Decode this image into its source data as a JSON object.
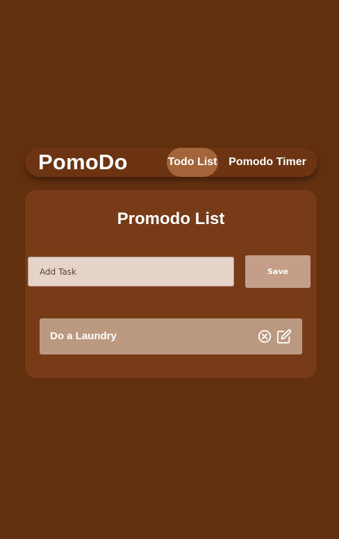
{
  "navbar": {
    "brand": "PomoDo",
    "links": [
      {
        "label": "Todo List",
        "active": true
      },
      {
        "label": "Pomodo Timer",
        "active": false
      }
    ]
  },
  "todo": {
    "title": "Promodo List",
    "input": {
      "placeholder": "Add Task",
      "value": ""
    },
    "save_label": "Save",
    "tasks": [
      {
        "label": "Do a Laundry"
      }
    ]
  },
  "icons": {
    "delete": "circle-x-icon",
    "edit": "edit-icon"
  },
  "colors": {
    "background": "#62300f",
    "navbar": "#6c3412",
    "active_tab": "#a4653a",
    "card": "#773b17",
    "input": "#e6d3c9",
    "save_button": "#c49e88",
    "task_item": "#bb9981",
    "text": "#ffffff"
  }
}
